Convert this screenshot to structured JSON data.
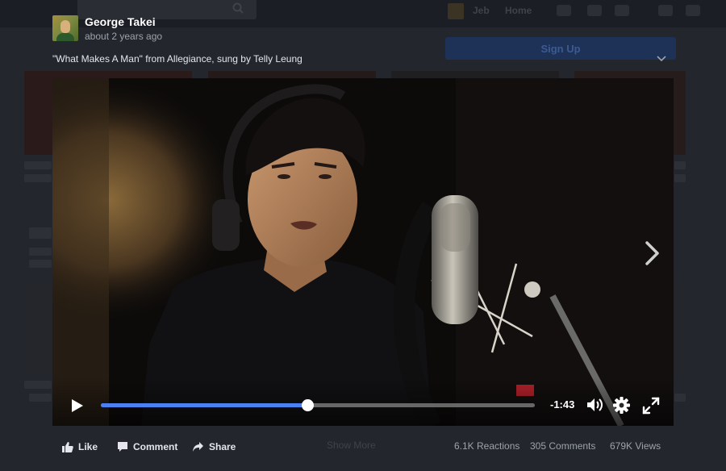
{
  "background": {
    "nav_user": "Jeb",
    "nav_home": "Home",
    "signup_label": "Sign Up",
    "show_more": "Show More"
  },
  "post": {
    "author": "George Takei",
    "timestamp": "about 2 years ago",
    "caption": "\"What Makes A Man\" from Allegiance, sung by Telly Leung"
  },
  "player": {
    "progress_fraction": 0.475,
    "time_remaining": "-1:43",
    "accent_color": "#4a80f0",
    "icons": [
      "play-icon",
      "volume-icon",
      "settings-gear-icon",
      "fullscreen-icon",
      "next-arrow-icon"
    ]
  },
  "actions": {
    "like": "Like",
    "comment": "Comment",
    "share": "Share"
  },
  "stats": {
    "reactions": "6.1K Reactions",
    "comments": "305 Comments",
    "views": "679K Views"
  }
}
